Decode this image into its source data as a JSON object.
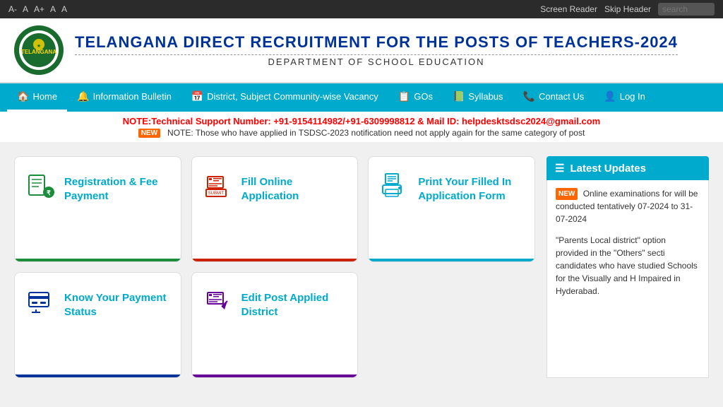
{
  "topbar": {
    "font_buttons": [
      "A-",
      "A",
      "A+",
      "A",
      "A"
    ],
    "screen_reader": "Screen Reader",
    "skip_header": "Skip Header",
    "search_placeholder": "search"
  },
  "header": {
    "title": "TELANGANA DIRECT RECRUITMENT FOR THE POSTS OF TEACHERS-2024",
    "subtitle": "DEPARTMENT OF SCHOOL EDUCATION"
  },
  "nav": {
    "items": [
      {
        "label": "Home",
        "icon": "🏠",
        "active": true
      },
      {
        "label": "Information Bulletin",
        "icon": "🔔"
      },
      {
        "label": "District, Subject Community-wise Vacancy",
        "icon": "📅"
      },
      {
        "label": "GOs",
        "icon": "📋"
      },
      {
        "label": "Syllabus",
        "icon": "📗"
      },
      {
        "label": "Contact Us",
        "icon": "📞"
      },
      {
        "label": "Log In",
        "icon": "👤"
      }
    ]
  },
  "notices": {
    "main": "NOTE:Technical Support Number: +91-9154114982/+91-6309998812 & Mail ID: helpdesktsdsc2024@gmail.com",
    "sub": "NOTE: Those who have applied in TSDSC-2023 notification need not apply again for the same category of post"
  },
  "cards": [
    {
      "id": "registration-fee",
      "label": "Registration & Fee Payment",
      "border_color": "green",
      "icon_color": "green"
    },
    {
      "id": "fill-application",
      "label": "Fill Online Application",
      "border_color": "red",
      "icon_color": "red"
    },
    {
      "id": "print-application",
      "label": "Print Your Filled In Application Form",
      "border_color": "teal",
      "icon_color": "teal"
    },
    {
      "id": "payment-status",
      "label": "Know Your Payment Status",
      "border_color": "blue",
      "icon_color": "blue"
    },
    {
      "id": "edit-district",
      "label": "Edit Post Applied District",
      "border_color": "purple",
      "icon_color": "purple"
    }
  ],
  "latest_updates": {
    "title": "Latest Updates",
    "items": [
      "Online examinations for will be conducted tentatively 07-2024 to 31-07-2024",
      "\"Parents Local district\" option provided in the \"Others\" secti candidates who have studied Schools for the Visually and H Impaired in Hyderabad."
    ]
  }
}
